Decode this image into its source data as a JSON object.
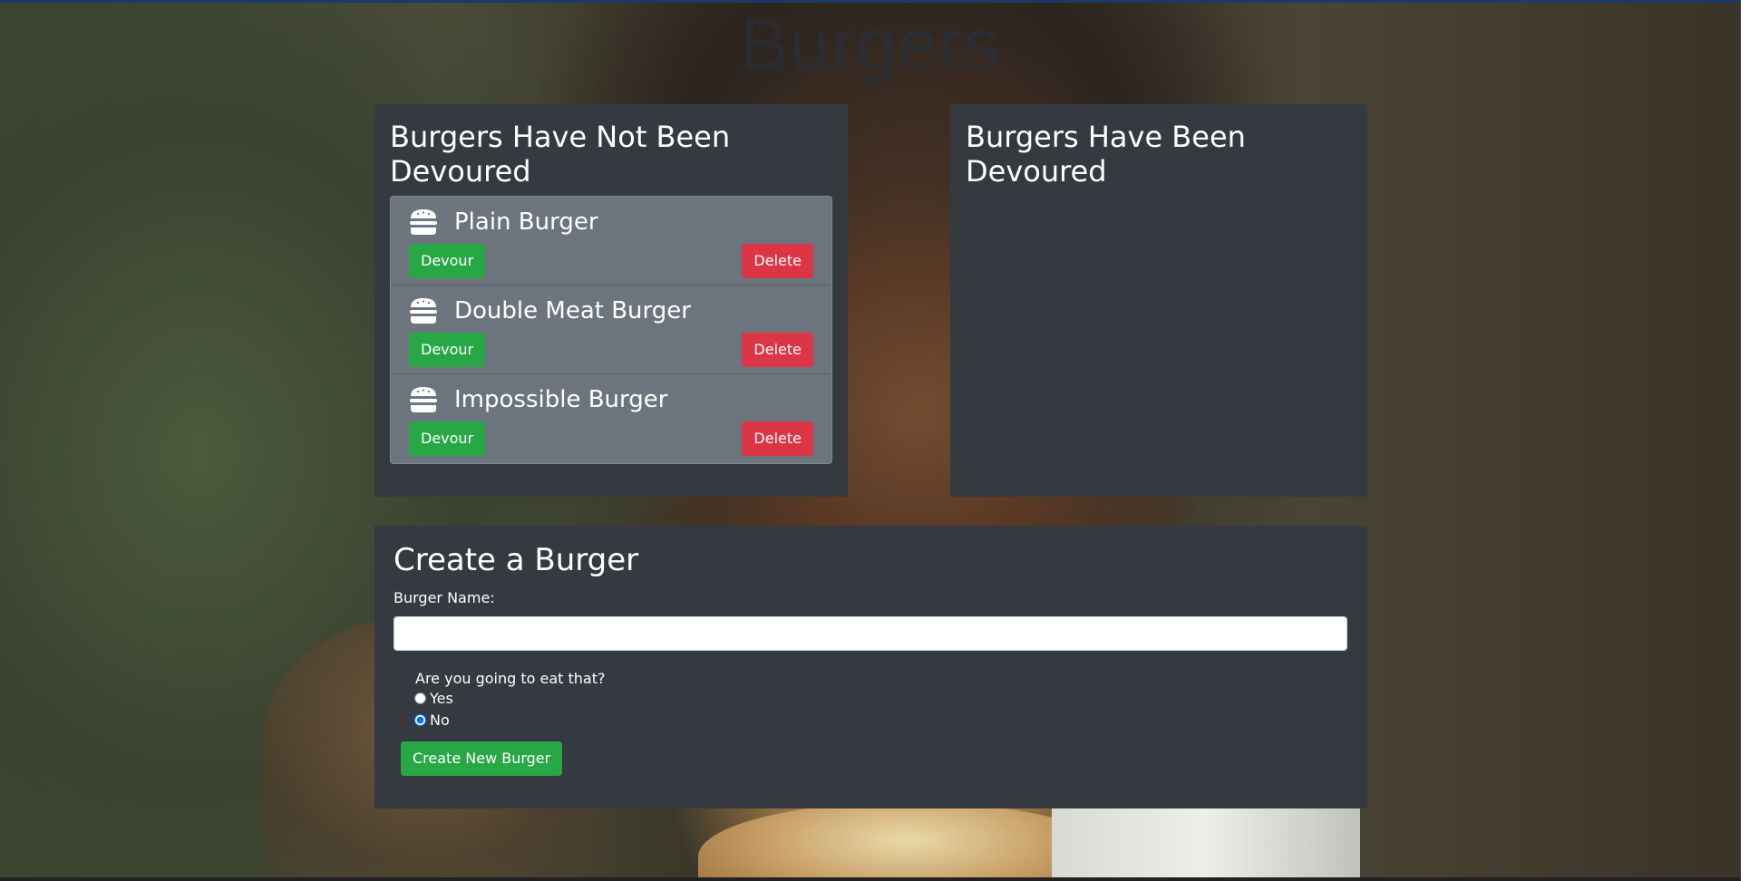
{
  "site_title": "Burgers",
  "not_devoured": {
    "heading": "Burgers Have Not Been Devoured",
    "items": [
      {
        "name": "Plain Burger",
        "devour_label": "Devour",
        "delete_label": "Delete"
      },
      {
        "name": "Double Meat Burger",
        "devour_label": "Devour",
        "delete_label": "Delete"
      },
      {
        "name": "Impossible Burger",
        "devour_label": "Devour",
        "delete_label": "Delete"
      }
    ]
  },
  "devoured": {
    "heading": "Burgers Have Been Devoured",
    "items": []
  },
  "create": {
    "heading": "Create a Burger",
    "name_label": "Burger Name:",
    "name_value": "",
    "question": "Are you going to eat that?",
    "options": [
      {
        "label": "Yes",
        "checked": false
      },
      {
        "label": "No",
        "checked": true
      }
    ],
    "submit_label": "Create New Burger"
  },
  "colors": {
    "panel": "#343a40",
    "list_bg": "#6c757d",
    "success": "#28a745",
    "danger": "#dc3545"
  },
  "icons": {
    "burger": "hamburger-icon"
  }
}
